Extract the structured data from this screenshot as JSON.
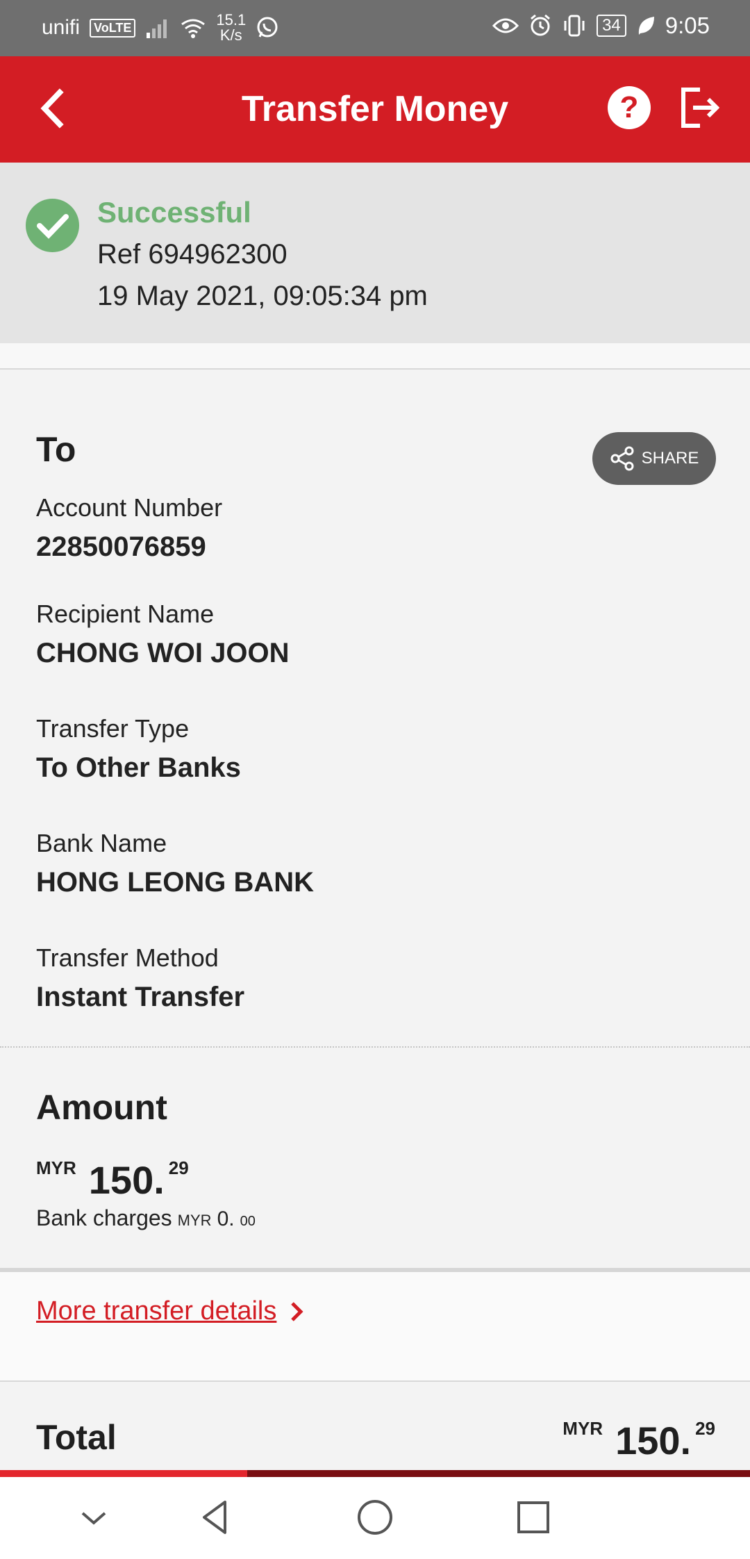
{
  "status_bar": {
    "carrier": "unifi",
    "volte": "VoLTE",
    "speed_value": "15.1",
    "speed_unit": "K/s",
    "battery": "34",
    "time": "9:05"
  },
  "header": {
    "title": "Transfer Money",
    "help_label": "?"
  },
  "status": {
    "label": "Successful",
    "ref": "Ref 694962300",
    "datetime": "19 May 2021, 09:05:34 pm",
    "color": "#6fb274"
  },
  "details": {
    "heading": "To",
    "share_label": "SHARE",
    "fields": [
      {
        "label": "Account Number",
        "value": "22850076859"
      },
      {
        "label": "Recipient Name",
        "value": "CHONG WOI JOON"
      },
      {
        "label": "Transfer Type",
        "value": "To Other Banks"
      },
      {
        "label": "Bank Name",
        "value": "HONG LEONG BANK"
      },
      {
        "label": "Transfer Method",
        "value": "Instant Transfer"
      }
    ]
  },
  "amount": {
    "heading": "Amount",
    "currency": "MYR",
    "whole": "150.",
    "decimal": "29",
    "charges_label": "Bank charges",
    "charges_currency": "MYR",
    "charges_whole": "0.",
    "charges_decimal": "00"
  },
  "more_details": {
    "label": "More transfer details"
  },
  "total": {
    "label": "Total",
    "currency": "MYR",
    "whole": "150.",
    "decimal": "29"
  },
  "progress": {
    "fraction": 0.33
  },
  "colors": {
    "brand_red": "#d31d24",
    "success_green": "#6fb274"
  }
}
